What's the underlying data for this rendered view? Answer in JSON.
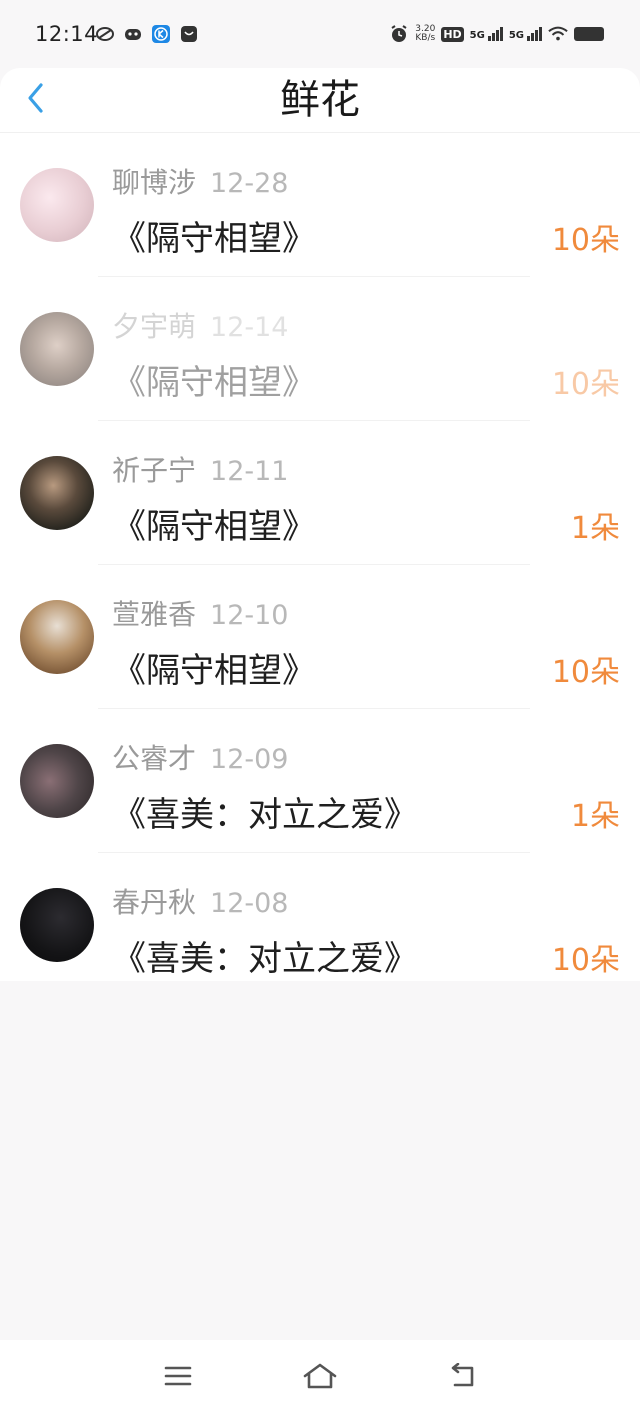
{
  "status_bar": {
    "time": "12:14",
    "net_speed_top": "3.20",
    "net_speed_bottom": "KB/s",
    "hd": "HD",
    "signal1": "5G",
    "signal2": "5G",
    "icons": [
      "sync-icon",
      "cat-app-icon",
      "k-app-icon",
      "bag-app-icon",
      "alarm-icon",
      "wifi-icon",
      "battery-icon"
    ]
  },
  "header": {
    "title": "鲜花",
    "back_icon": "chevron-left-icon",
    "accent_color": "#3aa0e6"
  },
  "items": [
    {
      "name": "聊博涉",
      "date": "12-28",
      "book": "《隔守相望》",
      "count": "10朵",
      "avatar_color": "#e8cdd3",
      "dim": false
    },
    {
      "name": "夕宇萌",
      "date": "12-14",
      "book": "《隔守相望》",
      "count": "10朵",
      "avatar_color": "#9a8f8c",
      "dim": true
    },
    {
      "name": "祈子宁",
      "date": "12-11",
      "book": "《隔守相望》",
      "count": "1朵",
      "avatar_color": "#3b3a33",
      "dim": false
    },
    {
      "name": "萱雅香",
      "date": "12-10",
      "book": "《隔守相望》",
      "count": "10朵",
      "avatar_color": "#b59067",
      "dim": false
    },
    {
      "name": "公睿才",
      "date": "12-09",
      "book": "《喜美：对立之爱》",
      "count": "1朵",
      "avatar_color": "#4f4548",
      "dim": false
    },
    {
      "name": "春丹秋",
      "date": "12-08",
      "book": "《喜美：对立之爱》",
      "count": "10朵",
      "avatar_color": "#141416",
      "dim": false
    }
  ],
  "colors": {
    "count": "#f08a3c",
    "background": "#f8f7f8"
  },
  "nav_bar": {
    "icons": [
      "menu-icon",
      "home-icon",
      "back-icon"
    ]
  }
}
